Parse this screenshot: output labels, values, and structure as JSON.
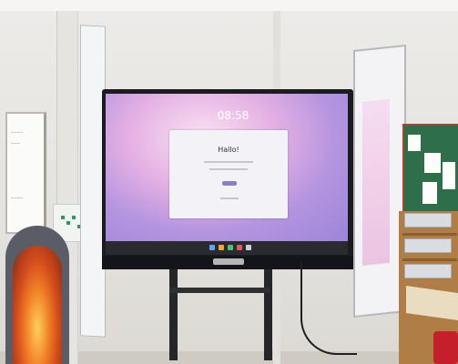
{
  "scene": {
    "description_free": true,
    "screen": {
      "clock": "08:58",
      "dialog_title": "Hallo!"
    },
    "colors": {
      "screen_gradient": [
        "#f9e3f4",
        "#e6b1e4",
        "#b494df"
      ],
      "noticeboard": "#2f6e4b",
      "fire": "#f07d25",
      "chair": "#c41f2b"
    }
  }
}
